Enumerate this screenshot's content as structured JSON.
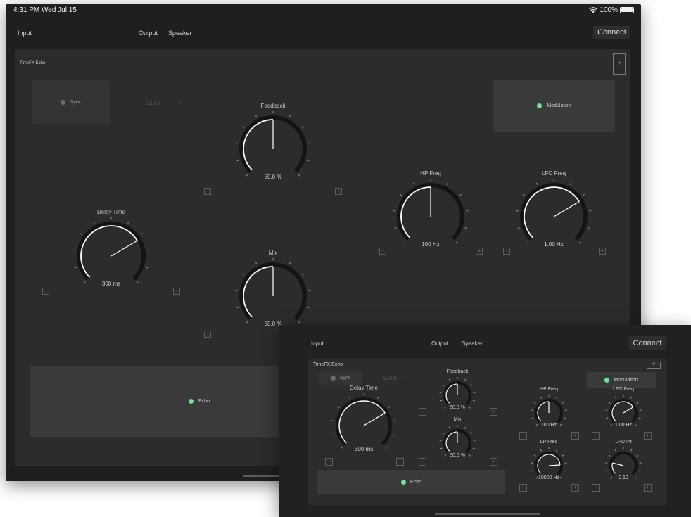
{
  "status_bar": {
    "time": "4:31 PM  Wed Jul 15",
    "battery": "100%"
  },
  "nav": {
    "input": "Input",
    "output": "Output",
    "speaker": "Speaker",
    "connect": "Connect"
  },
  "panel": {
    "title": "TimeFX Echo",
    "help": "?"
  },
  "sync": {
    "label": "Sync",
    "minus": "-",
    "bpm": "120.0",
    "plus": "+"
  },
  "modulation": {
    "label": "Modulation",
    "on": true
  },
  "echo": {
    "label": "Echo",
    "on": true
  },
  "stepper": {
    "minus": "-",
    "plus": "+"
  },
  "knobs": {
    "delay_time": {
      "label": "Delay Time",
      "value": "300 ms",
      "level": 0.72
    },
    "feedback": {
      "label": "Feedback",
      "value": "50.0 %",
      "level": 0.5
    },
    "mix": {
      "label": "Mix",
      "value": "50.0 %",
      "level": 0.5
    },
    "hp_freq": {
      "label": "HP Freq",
      "value": "100 Hz",
      "level": 0.5
    },
    "lfo_freq": {
      "label": "LFO Freq",
      "value": "1.00 Hz",
      "level": 0.72
    },
    "lp_freq": {
      "label": "LP Freq",
      "value": "10000 Hz",
      "level": 0.82
    },
    "lfo_int": {
      "label": "LFO Int",
      "value": "0.10",
      "level": 0.22
    }
  },
  "colors": {
    "accent_led": "#6fe3a0",
    "knob_fill": "#ffffff",
    "knob_track": "#141414",
    "panel": "#2c2c2c"
  }
}
